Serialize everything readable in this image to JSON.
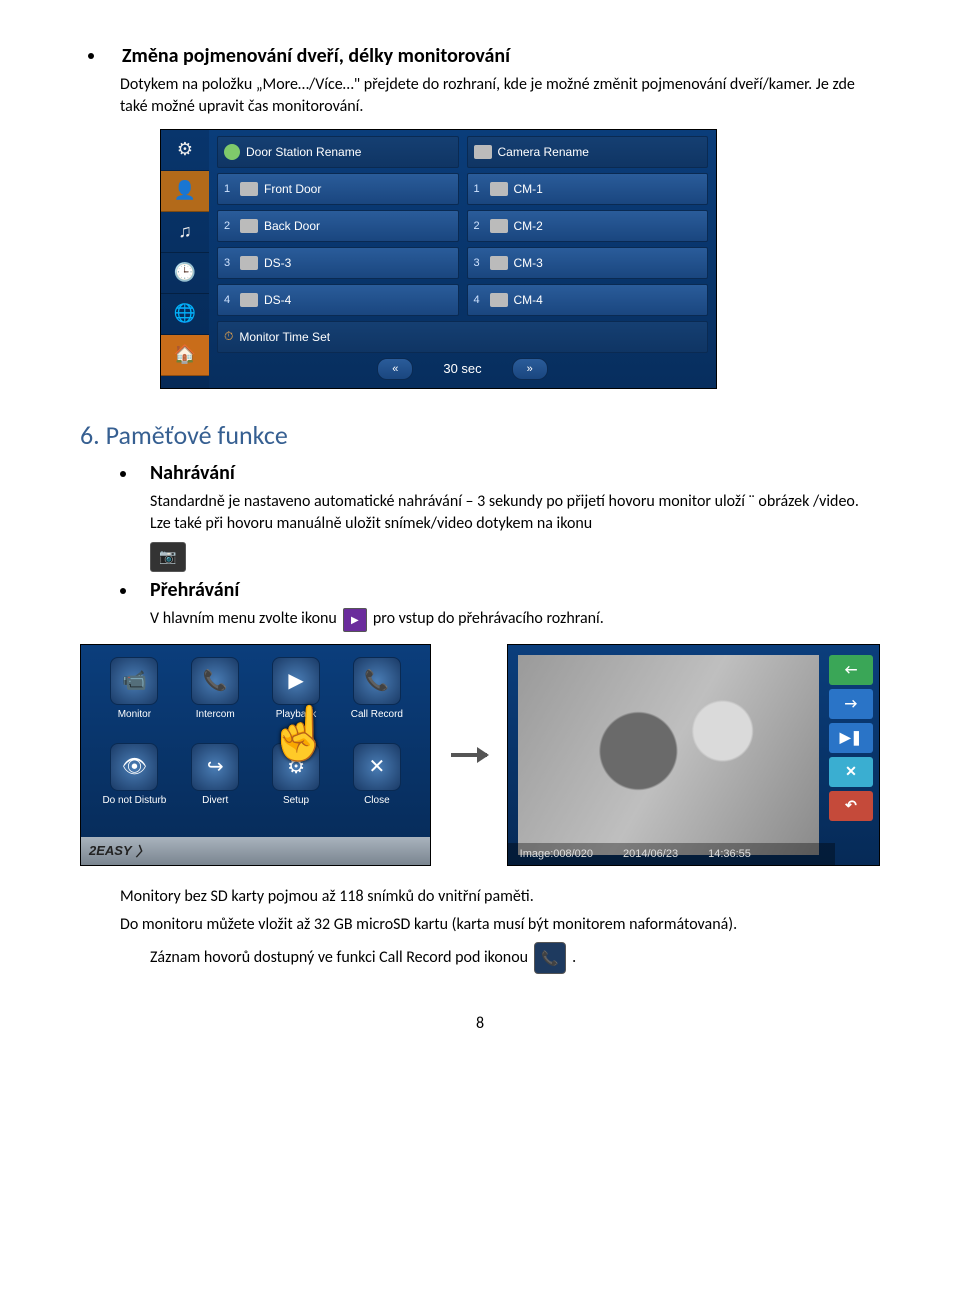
{
  "section1": {
    "title": "Změna pojmenování dveří, délky monitorování",
    "para": "Dotykem na položku „More…/Více…\" přejdete do rozhraní, kde je možné změnit pojmenování dveří/kamer. Je zde také možné upravit čas monitorování."
  },
  "settingsScreen": {
    "sidebar": [
      "gear",
      "person",
      "music",
      "clock",
      "globe",
      "home"
    ],
    "header_left": "Door Station Rename",
    "header_right": "Camera Rename",
    "doors": [
      "Front Door",
      "Back Door",
      "DS-3",
      "DS-4"
    ],
    "cameras": [
      "CM-1",
      "CM-2",
      "CM-3",
      "CM-4"
    ],
    "monitor_time_label": "Monitor Time Set",
    "time_value": "30 sec"
  },
  "section2": {
    "number_title": "6. Paměťové funkce",
    "sub1": "Nahrávání",
    "sub1_para": "Standardně je nastaveno automatické nahrávání – 3 sekundy po přijetí hovoru monitor uloží ¨ obrázek /video. Lze také při hovoru manuálně uložit snímek/video dotykem na ikonu",
    "sub2": "Přehrávání",
    "sub2_text_before": "V hlavním menu zvolte ikonu",
    "sub2_text_after": "pro vstup do přehrávacího rozhraní."
  },
  "mainMenu": {
    "items": [
      {
        "label": "Monitor",
        "glyph": "📹"
      },
      {
        "label": "Intercom",
        "glyph": "📞"
      },
      {
        "label": "Playback",
        "glyph": "▶"
      },
      {
        "label": "Call Record",
        "glyph": "📞"
      },
      {
        "label": "Do not Disturb",
        "glyph": "👁"
      },
      {
        "label": "Divert",
        "glyph": "↪"
      },
      {
        "label": "Setup",
        "glyph": "⚙"
      },
      {
        "label": "Close",
        "glyph": "✕"
      }
    ],
    "footer_brand": "2EASY"
  },
  "playback": {
    "footer_image": "Image:008/020",
    "footer_date": "2014/06/23",
    "footer_time": "14:36:55",
    "btns": [
      "←",
      "→",
      "▶❚",
      "✕",
      "↶"
    ]
  },
  "footer_para1": "Monitory bez SD karty pojmou až 118 snímků do vnitřní paměti.",
  "footer_para2": "Do monitoru můžete vložit až 32 GB microSD kartu (karta musí být monitorem naformátovaná).",
  "footer_para3_before": "Záznam hovorů dostupný ve funkci Call Record pod ikonou",
  "footer_para3_after": ".",
  "page_number": "8"
}
